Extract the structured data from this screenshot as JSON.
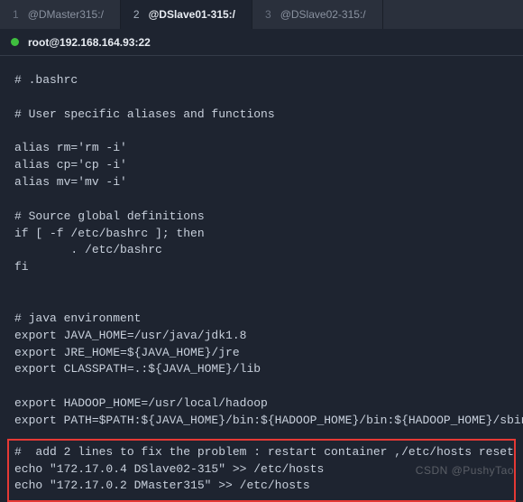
{
  "tabs": [
    {
      "num": "1",
      "title": "@DMaster315:/"
    },
    {
      "num": "2",
      "title": "@DSlave01-315:/"
    },
    {
      "num": "3",
      "title": "@DSlave02-315:/"
    }
  ],
  "active_tab_index": 1,
  "status": {
    "host": "root@192.168.164.93:22"
  },
  "terminal": {
    "body": "# .bashrc\n\n# User specific aliases and functions\n\nalias rm='rm -i'\nalias cp='cp -i'\nalias mv='mv -i'\n\n# Source global definitions\nif [ -f /etc/bashrc ]; then\n        . /etc/bashrc\nfi\n\n\n# java environment\nexport JAVA_HOME=/usr/java/jdk1.8\nexport JRE_HOME=${JAVA_HOME}/jre\nexport CLASSPATH=.:${JAVA_HOME}/lib\n\nexport HADOOP_HOME=/usr/local/hadoop\nexport PATH=$PATH:${JAVA_HOME}/bin:${HADOOP_HOME}/bin:${HADOOP_HOME}/sbin\n",
    "highlight": "#  add 2 lines to fix the problem : restart container ,/etc/hosts reset\necho \"172.17.0.4 DSlave02-315\" >> /etc/hosts\necho \"172.17.0.2 DMaster315\" >> /etc/hosts"
  },
  "watermark": "CSDN @PushyTao"
}
